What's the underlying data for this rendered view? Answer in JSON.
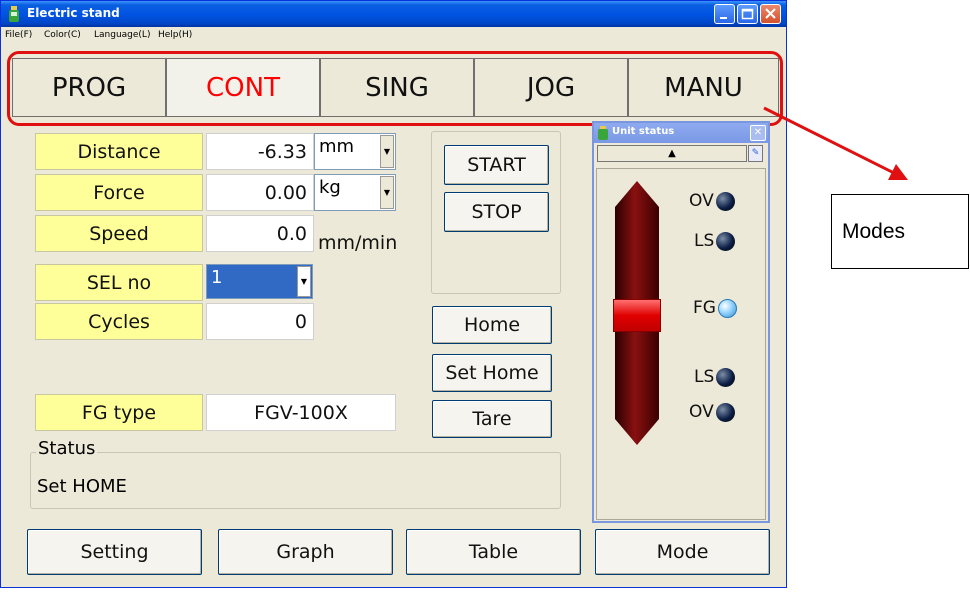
{
  "window": {
    "title": "Electric stand",
    "menu": [
      "File(F)",
      "Color(C)",
      "Language(L)",
      "Help(H)"
    ]
  },
  "modes": {
    "tabs": [
      "PROG",
      "CONT",
      "SING",
      "JOG",
      "MANU"
    ],
    "active": "CONT"
  },
  "fields": {
    "distance": {
      "label": "Distance",
      "value": "-6.33",
      "unit": "mm"
    },
    "force": {
      "label": "Force",
      "value": "0.00",
      "unit": "kg"
    },
    "speed": {
      "label": "Speed",
      "value": "0.0",
      "unit": "mm/min"
    },
    "sel_no": {
      "label": "SEL  no",
      "value": "1"
    },
    "cycles": {
      "label": "Cycles",
      "value": "0"
    },
    "fg_type": {
      "label": "FG type",
      "value": "FGV-100X"
    }
  },
  "buttons": {
    "start": "START",
    "stop": "STOP",
    "home": "Home",
    "set_home": "Set Home",
    "tare": "Tare"
  },
  "status": {
    "legend": "Status",
    "text": "Set HOME"
  },
  "bottom_buttons": {
    "setting": "Setting",
    "graph": "Graph",
    "table": "Table",
    "mode": "Mode"
  },
  "unit_status": {
    "title": "Unit status",
    "indicators": [
      {
        "label": "OV",
        "state": "off"
      },
      {
        "label": "LS",
        "state": "off"
      },
      {
        "label": "FG",
        "state": "on"
      },
      {
        "label": "LS",
        "state": "off"
      },
      {
        "label": "OV",
        "state": "off"
      }
    ]
  },
  "annotation": {
    "callout": "Modes",
    "color": "#e01010"
  },
  "colors": {
    "label_bg": "#ffff99",
    "active_tab_text": "#ff0000",
    "titlebar": "#0054e3"
  }
}
